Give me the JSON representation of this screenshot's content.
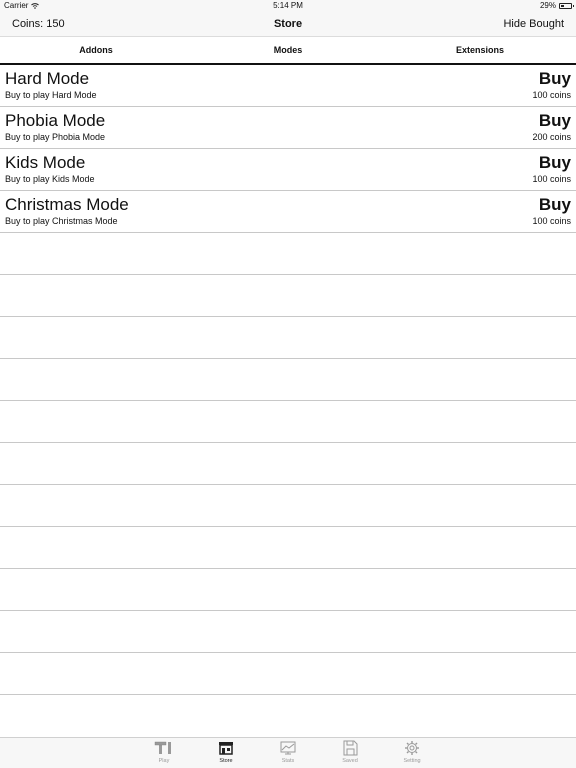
{
  "status_bar": {
    "carrier": "Carrier",
    "time": "5:14 PM",
    "battery": "29%",
    "battery_level": 0.29
  },
  "nav": {
    "coins": "Coins: 150",
    "title": "Store",
    "hide_bought": "Hide Bought"
  },
  "segments": [
    {
      "label": "Addons"
    },
    {
      "label": "Modes"
    },
    {
      "label": "Extensions"
    }
  ],
  "items": [
    {
      "title": "Hard Mode",
      "subtitle": "Buy to play Hard Mode",
      "action": "Buy",
      "price": "100 coins"
    },
    {
      "title": "Phobia Mode",
      "subtitle": "Buy to play Phobia Mode",
      "action": "Buy",
      "price": "200 coins"
    },
    {
      "title": "Kids Mode",
      "subtitle": "Buy to play Kids Mode",
      "action": "Buy",
      "price": "100 coins"
    },
    {
      "title": "Christmas Mode",
      "subtitle": "Buy to play Christmas Mode",
      "action": "Buy",
      "price": "100 coins"
    }
  ],
  "tabbar": [
    {
      "label": "Play",
      "icon": "ti-logo-icon",
      "active": false
    },
    {
      "label": "Store",
      "icon": "store-icon",
      "active": true
    },
    {
      "label": "Stats",
      "icon": "stats-chart-icon",
      "active": false
    },
    {
      "label": "Saved",
      "icon": "floppy-disk-icon",
      "active": false
    },
    {
      "label": "Setting",
      "icon": "gear-icon",
      "active": false
    }
  ]
}
